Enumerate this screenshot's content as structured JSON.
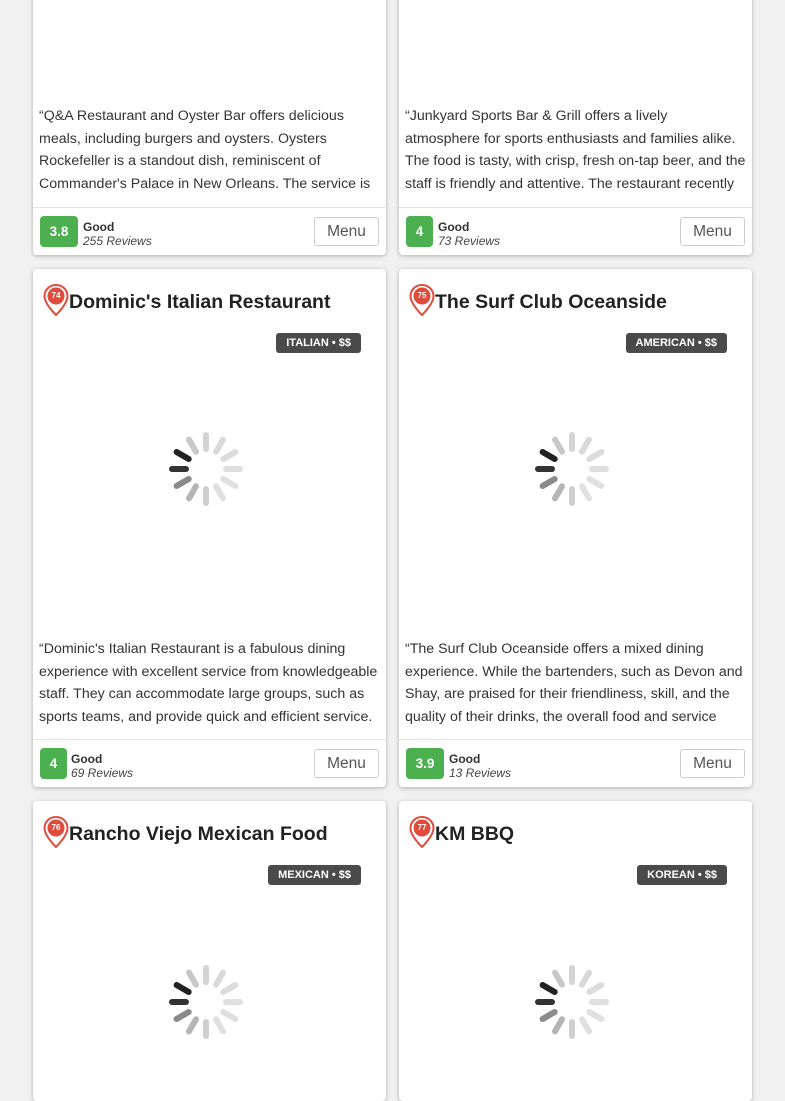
{
  "colors": {
    "score_bg": "#4caf50",
    "pin": "#e14b3c",
    "badge_bg": "#4a4a4a"
  },
  "cards": [
    {
      "description": "“Q&A Restaurant and Oyster Bar offers delicious meals, including burgers and oysters. Oysters Rockefeller is a standout dish, reminiscent of Commander's Palace in New Orleans. The service is",
      "score": "3.8",
      "rating": "Good",
      "reviews": "255 Reviews",
      "menu": "Menu"
    },
    {
      "description": "“Junkyard Sports Bar & Grill offers a lively atmosphere for sports enthusiasts and families alike. The food is tasty, with crisp, fresh on-tap beer, and the staff is friendly and attentive. The restaurant recently",
      "score": "4",
      "rating": "Good",
      "reviews": "73 Reviews",
      "menu": "Menu"
    },
    {
      "number": "74",
      "name": "Dominic's Italian Restaurant",
      "badge": "ITALIAN • $$",
      "description": "“Dominic's Italian Restaurant is a fabulous dining experience with excellent service from knowledgeable staff. They can accommodate large groups, such as sports teams, and provide quick and efficient service.",
      "score": "4",
      "rating": "Good",
      "reviews": "69 Reviews",
      "menu": "Menu"
    },
    {
      "number": "75",
      "name": "The Surf Club Oceanside",
      "badge": "AMERICAN • $$",
      "description": "“The Surf Club Oceanside offers a mixed dining experience. While the bartenders, such as Devon and Shay, are praised for their friendliness, skill, and the quality of their drinks, the overall food and service",
      "score": "3.9",
      "rating": "Good",
      "reviews": "13 Reviews",
      "menu": "Menu"
    },
    {
      "number": "76",
      "name": "Rancho Viejo Mexican Food",
      "badge": "MEXICAN • $$"
    },
    {
      "number": "77",
      "name": "KM BBQ",
      "badge": "KOREAN • $$"
    }
  ]
}
